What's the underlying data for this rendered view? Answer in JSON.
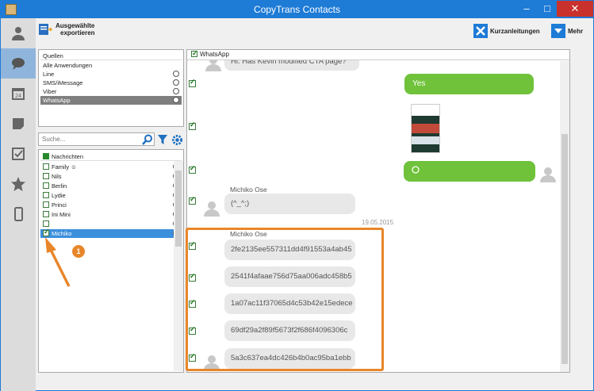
{
  "window": {
    "title": "CopyTrans Contacts"
  },
  "toolbar": {
    "export_label_line1": "Ausgewählte",
    "export_label_line2": "exportieren",
    "guides_label": "Kurzanleitungen",
    "more_label": "Mehr"
  },
  "sources": {
    "header": "Quellen",
    "items": [
      "Alle Anwendungen",
      "Line",
      "SMS/iMessage",
      "Viber",
      "WhatsApp"
    ]
  },
  "search": {
    "placeholder": "Suche..."
  },
  "contacts": {
    "header": "Nachrichten",
    "items": [
      "Family ☺",
      "Nils",
      "Berlin",
      "Lydie",
      "Princi",
      "Ini Mini",
      "",
      "Michiko"
    ]
  },
  "annotation": {
    "number": "1"
  },
  "chat": {
    "header": "WhatsApp",
    "top_partial": "Hi. Has Kevin modified CTA page?",
    "yes_msg": "Yes",
    "sender1": "Michiko Ose",
    "emoticon_msg": "(^_^;)",
    "date": "19.05.2015",
    "sender2": "Michiko Ose",
    "hashes": [
      "2fe2135ee557311dd4f91553a4ab45",
      "2541f4afaae756d75aa006adc458b5",
      "1a07ac11f37065d4c53b42e15edece",
      "69df29a2f89f5673f2f686f4096306c",
      "5a3c637ea4dc426b4b0ac95ba1ebb"
    ]
  },
  "colors": {
    "accent": "#1e7bd6",
    "green": "#6fc23a",
    "highlight": "#e8862a"
  }
}
